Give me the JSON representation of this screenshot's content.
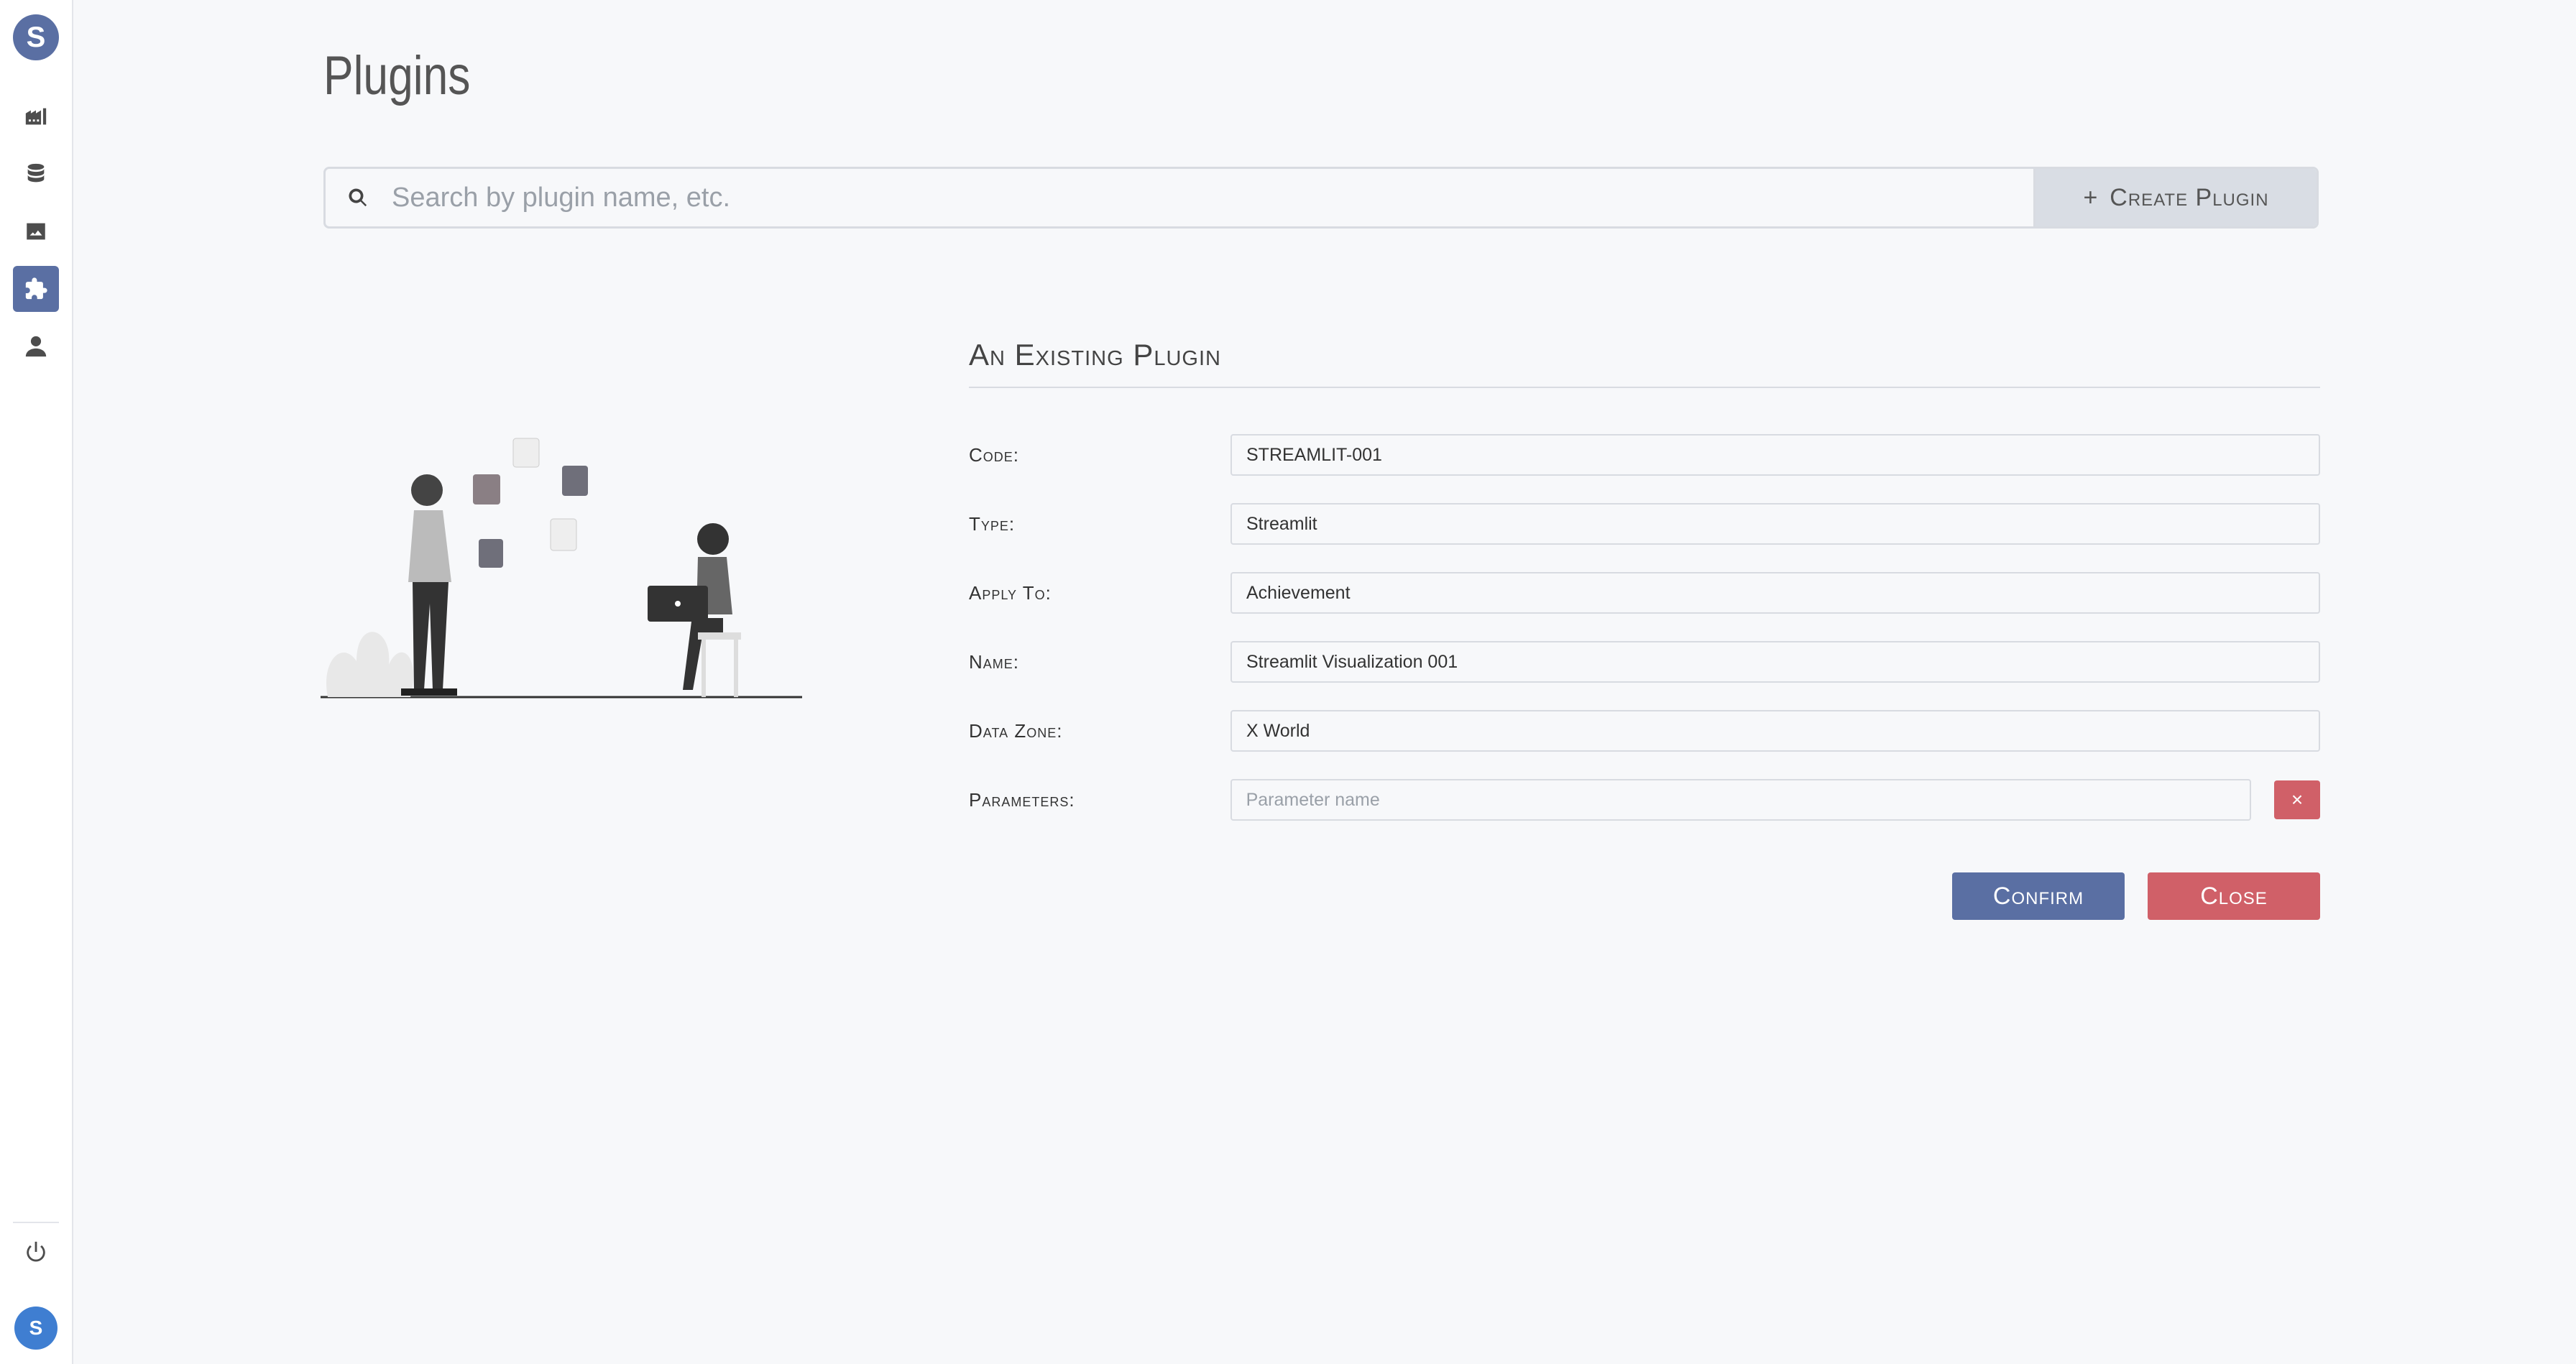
{
  "sidebar": {
    "logo": "S",
    "items": [
      {
        "name": "buildings-icon",
        "active": false
      },
      {
        "name": "database-icon",
        "active": false
      },
      {
        "name": "image-icon",
        "active": false
      },
      {
        "name": "puzzle-icon",
        "active": true
      },
      {
        "name": "user-icon",
        "active": false
      }
    ],
    "power_icon": "power-icon",
    "avatar_initial": "S"
  },
  "page": {
    "title": "Plugins"
  },
  "search": {
    "placeholder": "Search by plugin name, etc.",
    "create_label": "Create Plugin",
    "create_prefix": "+"
  },
  "form": {
    "title": "An Existing Plugin",
    "fields": [
      {
        "label": "Code:",
        "value": "STREAMLIT-001"
      },
      {
        "label": "Type:",
        "value": "Streamlit"
      },
      {
        "label": "Apply To:",
        "value": "Achievement"
      },
      {
        "label": "Name:",
        "value": "Streamlit Visualization 001"
      },
      {
        "label": "Data Zone:",
        "value": "X World"
      }
    ],
    "parameters": {
      "label": "Parameters:",
      "placeholder": "Parameter name",
      "delete_symbol": "×"
    },
    "confirm_label": "Confirm",
    "close_label": "Close"
  },
  "colors": {
    "accent": "#5a6fa3",
    "danger": "#d06068",
    "background": "#f7f8fa"
  }
}
